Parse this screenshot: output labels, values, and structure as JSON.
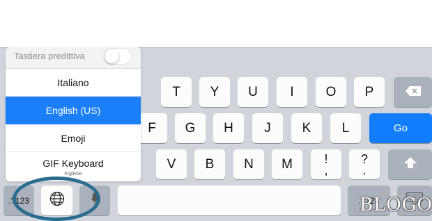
{
  "popover": {
    "predictive_label": "Tastiera predittiva",
    "predictive_enabled": false,
    "languages": [
      {
        "label": "Italiano",
        "selected": false
      },
      {
        "label": "English (US)",
        "selected": true
      },
      {
        "label": "Emoji",
        "selected": false
      },
      {
        "label": "GIF Keyboard",
        "sublabel": "inglese",
        "selected": false
      }
    ]
  },
  "keyboard": {
    "row1": [
      "T",
      "Y",
      "U",
      "I",
      "O",
      "P"
    ],
    "row2": [
      "F",
      "G",
      "H",
      "J",
      "K",
      "L"
    ],
    "go_label": "Go",
    "row3": [
      "V",
      "B",
      "N",
      "M"
    ],
    "punct1": {
      "top": "!",
      "bottom": ","
    },
    "punct2": {
      "top": "?",
      "bottom": "."
    },
    "numbers_label": ".?123",
    "icons": {
      "backspace": "backspace-icon",
      "shift": "shift-icon",
      "globe": "globe-icon",
      "mic": "microphone-icon",
      "hide": "keyboard-hide-icon"
    },
    "colors": {
      "go": "#127dfc",
      "selected_language": "#1a7ff9"
    }
  },
  "watermark": "BLOGO"
}
